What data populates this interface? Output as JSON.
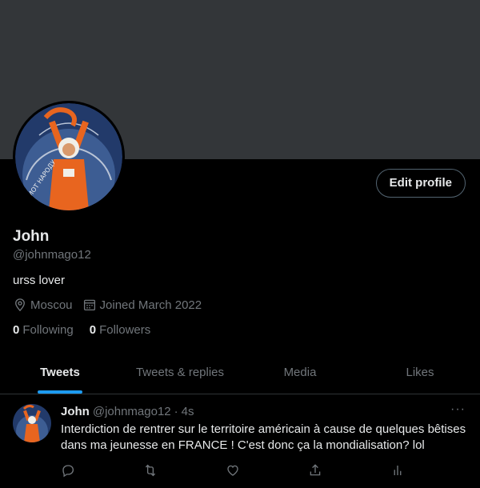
{
  "profile": {
    "name": "John",
    "handle": "@johnmago12",
    "bio": "urss lover",
    "location": "Moscou",
    "joined": "Joined March 2022",
    "following_count": "0",
    "following_label": "Following",
    "followers_count": "0",
    "followers_label": "Followers",
    "edit_label": "Edit profile"
  },
  "tabs": [
    {
      "label": "Tweets",
      "active": true
    },
    {
      "label": "Tweets & replies",
      "active": false
    },
    {
      "label": "Media",
      "active": false
    },
    {
      "label": "Likes",
      "active": false
    }
  ],
  "tweet": {
    "name": "John",
    "handle": "@johnmago12",
    "separator": "·",
    "time": "4s",
    "more": "···",
    "text": "Interdiction de rentrer sur le territoire américain à cause de quelques bêtises dans ma jeunesse en FRANCE ! C'est donc ça la mondialisation? lol",
    "actions": [
      "reply-icon",
      "retweet-icon",
      "like-icon",
      "share-icon",
      "analytics-icon"
    ]
  },
  "icons": {
    "location": "location-pin-icon",
    "calendar": "calendar-icon"
  },
  "colors": {
    "background": "#000000",
    "banner": "#333639",
    "accent": "#1d9bf0",
    "text": "#e7e9ea",
    "muted": "#71767b",
    "avatar_bg": "#223a6a",
    "avatar_figure": "#e8651f"
  }
}
